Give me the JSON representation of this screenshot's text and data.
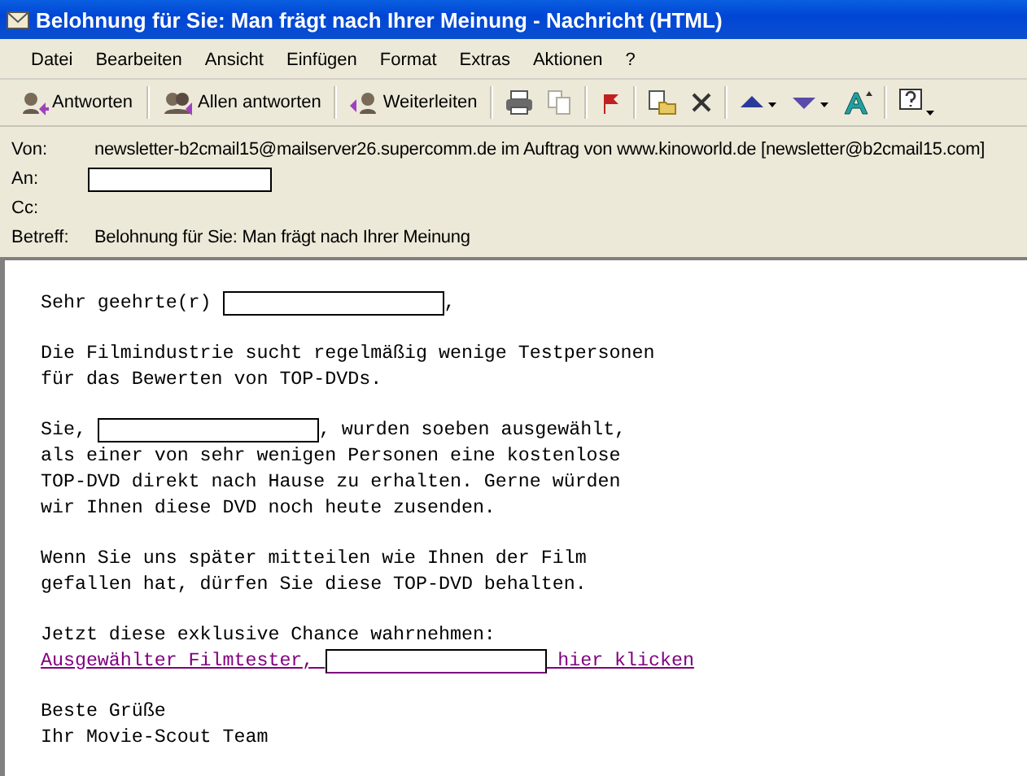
{
  "window": {
    "title": "Belohnung für Sie: Man frägt nach Ihrer Meinung - Nachricht (HTML)"
  },
  "menu": [
    "Datei",
    "Bearbeiten",
    "Ansicht",
    "Einfügen",
    "Format",
    "Extras",
    "Aktionen",
    "?"
  ],
  "toolbar": {
    "buttons": [
      {
        "label": "Antworten",
        "kind": "reply"
      },
      {
        "label": "Allen antworten",
        "kind": "replyall"
      },
      {
        "label": "Weiterleiten",
        "kind": "forward"
      }
    ],
    "icons": [
      {
        "kind": "print",
        "disabled": false
      },
      {
        "kind": "copy",
        "disabled": true
      },
      {
        "kind": "flag",
        "disabled": false
      },
      {
        "kind": "move",
        "disabled": false
      },
      {
        "kind": "delete",
        "disabled": false
      },
      {
        "kind": "up",
        "disabled": false
      },
      {
        "kind": "down",
        "disabled": false
      },
      {
        "kind": "font",
        "disabled": false
      },
      {
        "kind": "help",
        "disabled": false
      }
    ]
  },
  "header": [
    {
      "label": "Von:",
      "kind": "text",
      "value": "newsletter-b2cmail15@mailserver26.supercomm.de im Auftrag von www.kinoworld.de [newsletter@b2cmail15.com]"
    },
    {
      "label": "An:",
      "kind": "redacted"
    },
    {
      "label": "Cc:",
      "kind": "empty"
    },
    {
      "label": "Betreff:",
      "kind": "text",
      "value": "Belohnung für Sie: Man frägt nach Ihrer Meinung"
    }
  ],
  "body": [
    [
      [
        {
          "kind": "text",
          "text": "Sehr geehrte(r) "
        },
        {
          "kind": "redacted"
        },
        {
          "kind": "text",
          "text": ","
        }
      ]
    ],
    [
      [
        {
          "kind": "text",
          "text": "Die Filmindustrie sucht regelmäßig wenige Testpersonen"
        }
      ],
      [
        {
          "kind": "text",
          "text": "für das Bewerten von TOP-DVDs."
        }
      ]
    ],
    [
      [
        {
          "kind": "text",
          "text": "Sie, "
        },
        {
          "kind": "redacted"
        },
        {
          "kind": "text",
          "text": ", wurden soeben ausgewählt,"
        }
      ],
      [
        {
          "kind": "text",
          "text": "als einer von sehr wenigen Personen eine kostenlose"
        }
      ],
      [
        {
          "kind": "text",
          "text": "TOP-DVD direkt nach Hause zu erhalten. Gerne würden"
        }
      ],
      [
        {
          "kind": "text",
          "text": "wir Ihnen diese DVD noch heute zusenden."
        }
      ]
    ],
    [
      [
        {
          "kind": "text",
          "text": "Wenn Sie uns später mitteilen wie Ihnen der Film"
        }
      ],
      [
        {
          "kind": "text",
          "text": "gefallen hat, dürfen Sie diese TOP-DVD behalten."
        }
      ]
    ],
    [
      [
        {
          "kind": "text",
          "text": "Jetzt diese exklusive Chance wahrnehmen:"
        }
      ],
      [
        {
          "kind": "link",
          "text": "Ausgewählter Filmtester, "
        },
        {
          "kind": "linkredacted"
        },
        {
          "kind": "link",
          "text": " hier klicken"
        }
      ]
    ],
    [
      [
        {
          "kind": "text",
          "text": "Beste Grüße"
        }
      ],
      [
        {
          "kind": "text",
          "text": "Ihr Movie-Scout Team"
        }
      ]
    ]
  ]
}
